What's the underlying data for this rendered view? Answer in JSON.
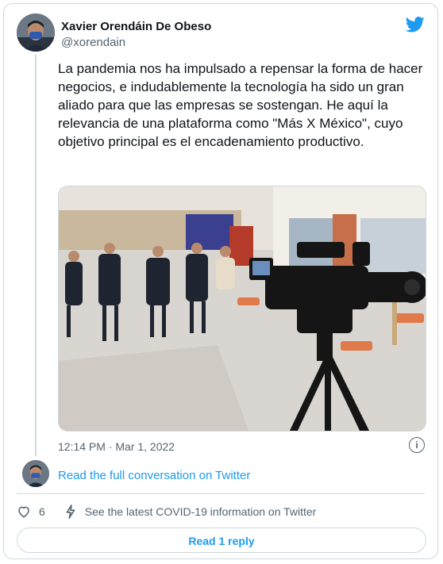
{
  "author": {
    "name": "Xavier Orendáin De Obeso",
    "handle": "@xorendain"
  },
  "tweet": {
    "text": "La pandemia nos ha impulsado a repensar la forma de hacer negocios, e indudablemente la tecnología ha sido un gran aliado para que las empresas se sostengan. He aquí la relevancia de una plataforma como \"Más X México\", cuyo objetivo principal es el encadenamiento productivo.",
    "timestamp": "12:14 PM · Mar 1, 2022"
  },
  "conversation_link": "Read the full conversation on Twitter",
  "actions": {
    "like_count": "6",
    "covid_info": "See the latest COVID-19 information on Twitter"
  },
  "reply_button": "Read 1 reply",
  "icons": {
    "brand": "twitter-bird-icon",
    "info": "info-icon",
    "like": "heart-icon",
    "covid": "lightning-icon"
  },
  "colors": {
    "accent": "#1d9bf0",
    "text": "#0f1419",
    "secondary": "#536471",
    "border": "#cfd9de"
  }
}
